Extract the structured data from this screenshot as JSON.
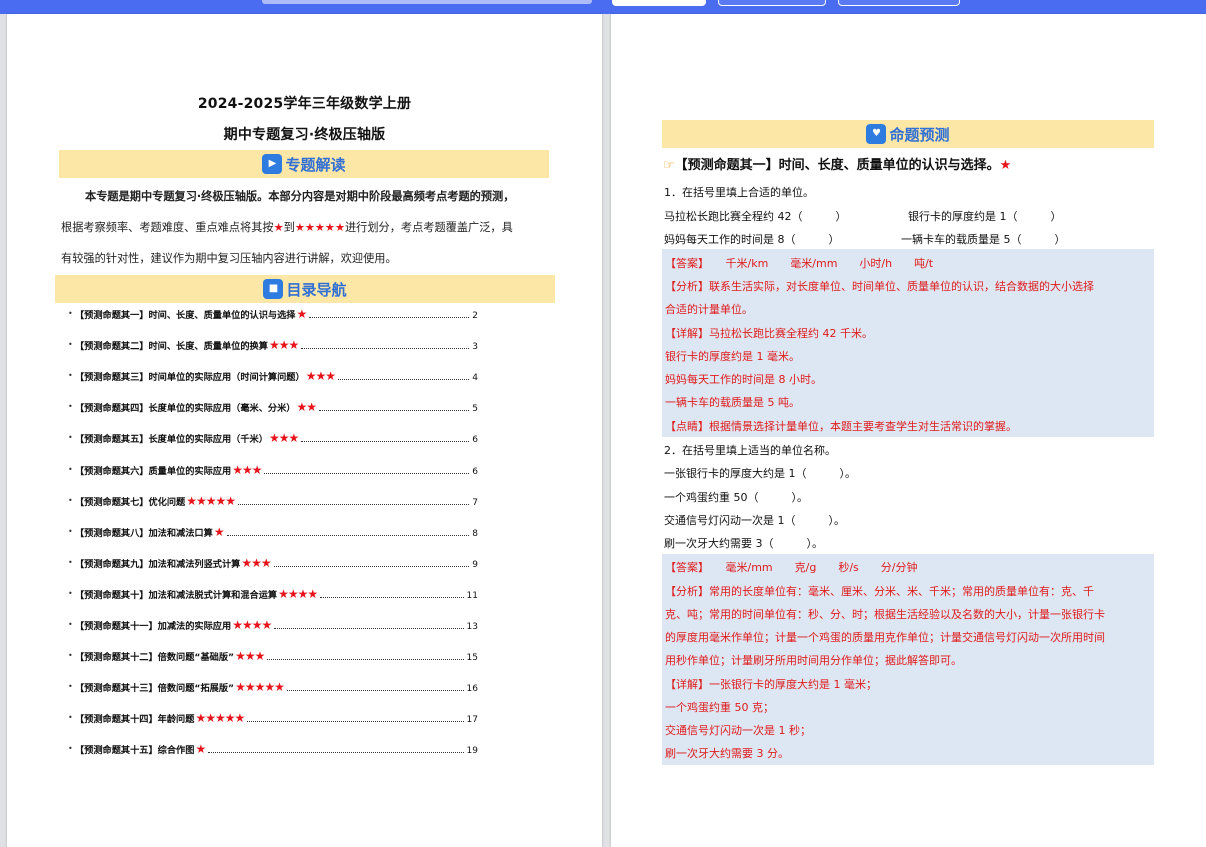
{
  "left": {
    "title1": "2024-2025学年三年级数学上册",
    "title2": "期中专题复习·终极压轴版",
    "banner_topic": "专题解读",
    "intro_lines": [
      "本专题是期中专题复习·终极压轴版。本部分内容是对期中阶段最高频考点考题的预测，",
      "根据考察频率、考题难度、重点难点将其按★到★★★★★进行划分，考点考题覆盖广泛，具",
      "有较强的针对性，建议作为期中复习压轴内容进行讲解，欢迎使用。"
    ],
    "banner_nav": "目录导航",
    "toc": [
      {
        "label": "【预测命题其一】时间、长度、质量单位的认识与选择",
        "stars": "★",
        "page": "2"
      },
      {
        "label": "【预测命题其二】时间、长度、质量单位的换算",
        "stars": "★★★",
        "page": "3"
      },
      {
        "label": "【预测命题其三】时间单位的实际应用（时间计算问题）",
        "stars": "★★★",
        "page": "4"
      },
      {
        "label": "【预测命题其四】长度单位的实际应用（毫米、分米）",
        "stars": "★★",
        "page": "5"
      },
      {
        "label": "【预测命题其五】长度单位的实际应用（千米）",
        "stars": "★★★",
        "page": "6"
      },
      {
        "label": "【预测命题其六】质量单位的实际应用",
        "stars": "★★★",
        "page": "6"
      },
      {
        "label": "【预测命题其七】优化问题",
        "stars": "★★★★★",
        "page": "7"
      },
      {
        "label": "【预测命题其八】加法和减法口算",
        "stars": "★",
        "page": "8"
      },
      {
        "label": "【预测命题其九】加法和减法列竖式计算",
        "stars": "★★★",
        "page": "9"
      },
      {
        "label": "【预测命题其十】加法和减法脱式计算和混合运算",
        "stars": "★★★★",
        "page": "11"
      },
      {
        "label": "【预测命题其十一】加减法的实际应用",
        "stars": "★★★★",
        "page": "13"
      },
      {
        "label": "【预测命题其十二】倍数问题“基础版”",
        "stars": "★★★",
        "page": "15"
      },
      {
        "label": "【预测命题其十三】倍数问题“拓展版”",
        "stars": "★★★★★",
        "page": "16"
      },
      {
        "label": "【预测命题其十四】年龄问题",
        "stars": "★★★★★",
        "page": "17"
      },
      {
        "label": "【预测命题其十五】综合作图",
        "stars": "★",
        "page": "19"
      }
    ]
  },
  "right": {
    "banner": "命题预测",
    "pred_title": "【预测命题其一】时间、长度、质量单位的认识与选择。",
    "pred_star": "★",
    "q1": {
      "stem": "1．在括号里填上合适的单位。",
      "row1a": "马拉松长跑比赛全程约 42（　　　）",
      "row1b": "银行卡的厚度约是 1（　　　）",
      "row2a": "妈妈每天工作的时间是 8（　　　）",
      "row2b": "一辆卡车的载质量是 5（　　　）",
      "answer": "【答案】　　千米/km　　毫米/mm　　小时/h　　吨/t",
      "analysis1": "【分析】联系生活实际，对长度单位、时间单位、质量单位的认识，结合数据的大小选择",
      "analysis2": "合适的计量单位。",
      "detail1": "【详解】马拉松长跑比赛全程约 42 千米。",
      "detail2": "银行卡的厚度约是 1 毫米。",
      "detail3": "妈妈每天工作的时间是 8 小时。",
      "detail4": "一辆卡车的载质量是 5 吨。",
      "comment": "【点睛】根据情景选择计量单位，本题主要考查学生对生活常识的掌握。"
    },
    "q2": {
      "stem": "2．在括号里填上适当的单位名称。",
      "l1": "一张银行卡的厚度大约是 1（　　　）。",
      "l2": "一个鸡蛋约重 50（　　　）。",
      "l3": "交通信号灯闪动一次是 1（　　　）。",
      "l4": "刷一次牙大约需要 3（　　　）。",
      "answer": "【答案】　　毫米/mm　　克/g　　秒/s　　分/分钟",
      "analysis1": "【分析】常用的长度单位有：毫米、厘米、分米、米、千米；常用的质量单位有：克、千",
      "analysis2": "克、吨；常用的时间单位有：秒、分、时；根据生活经验以及名数的大小，计量一张银行卡",
      "analysis3": "的厚度用毫米作单位；计量一个鸡蛋的质量用克作单位；计量交通信号灯闪动一次所用时间",
      "analysis4": "用秒作单位；计量刷牙所用时间用分作单位；据此解答即可。",
      "detail1": "【详解】一张银行卡的厚度大约是 1 毫米；",
      "detail2": "一个鸡蛋约重 50 克；",
      "detail3": "交通信号灯闪动一次是 1 秒；",
      "detail4": "刷一次牙大约需要 3 分。"
    }
  },
  "colors": {
    "banner_bg": "#fde7a6",
    "banner_text": "#2f6fd6",
    "answer_bg": "#dde7f3",
    "answer_text": "#e01b1b",
    "star": "#e8141b",
    "topbar": "#4a6cf0"
  }
}
